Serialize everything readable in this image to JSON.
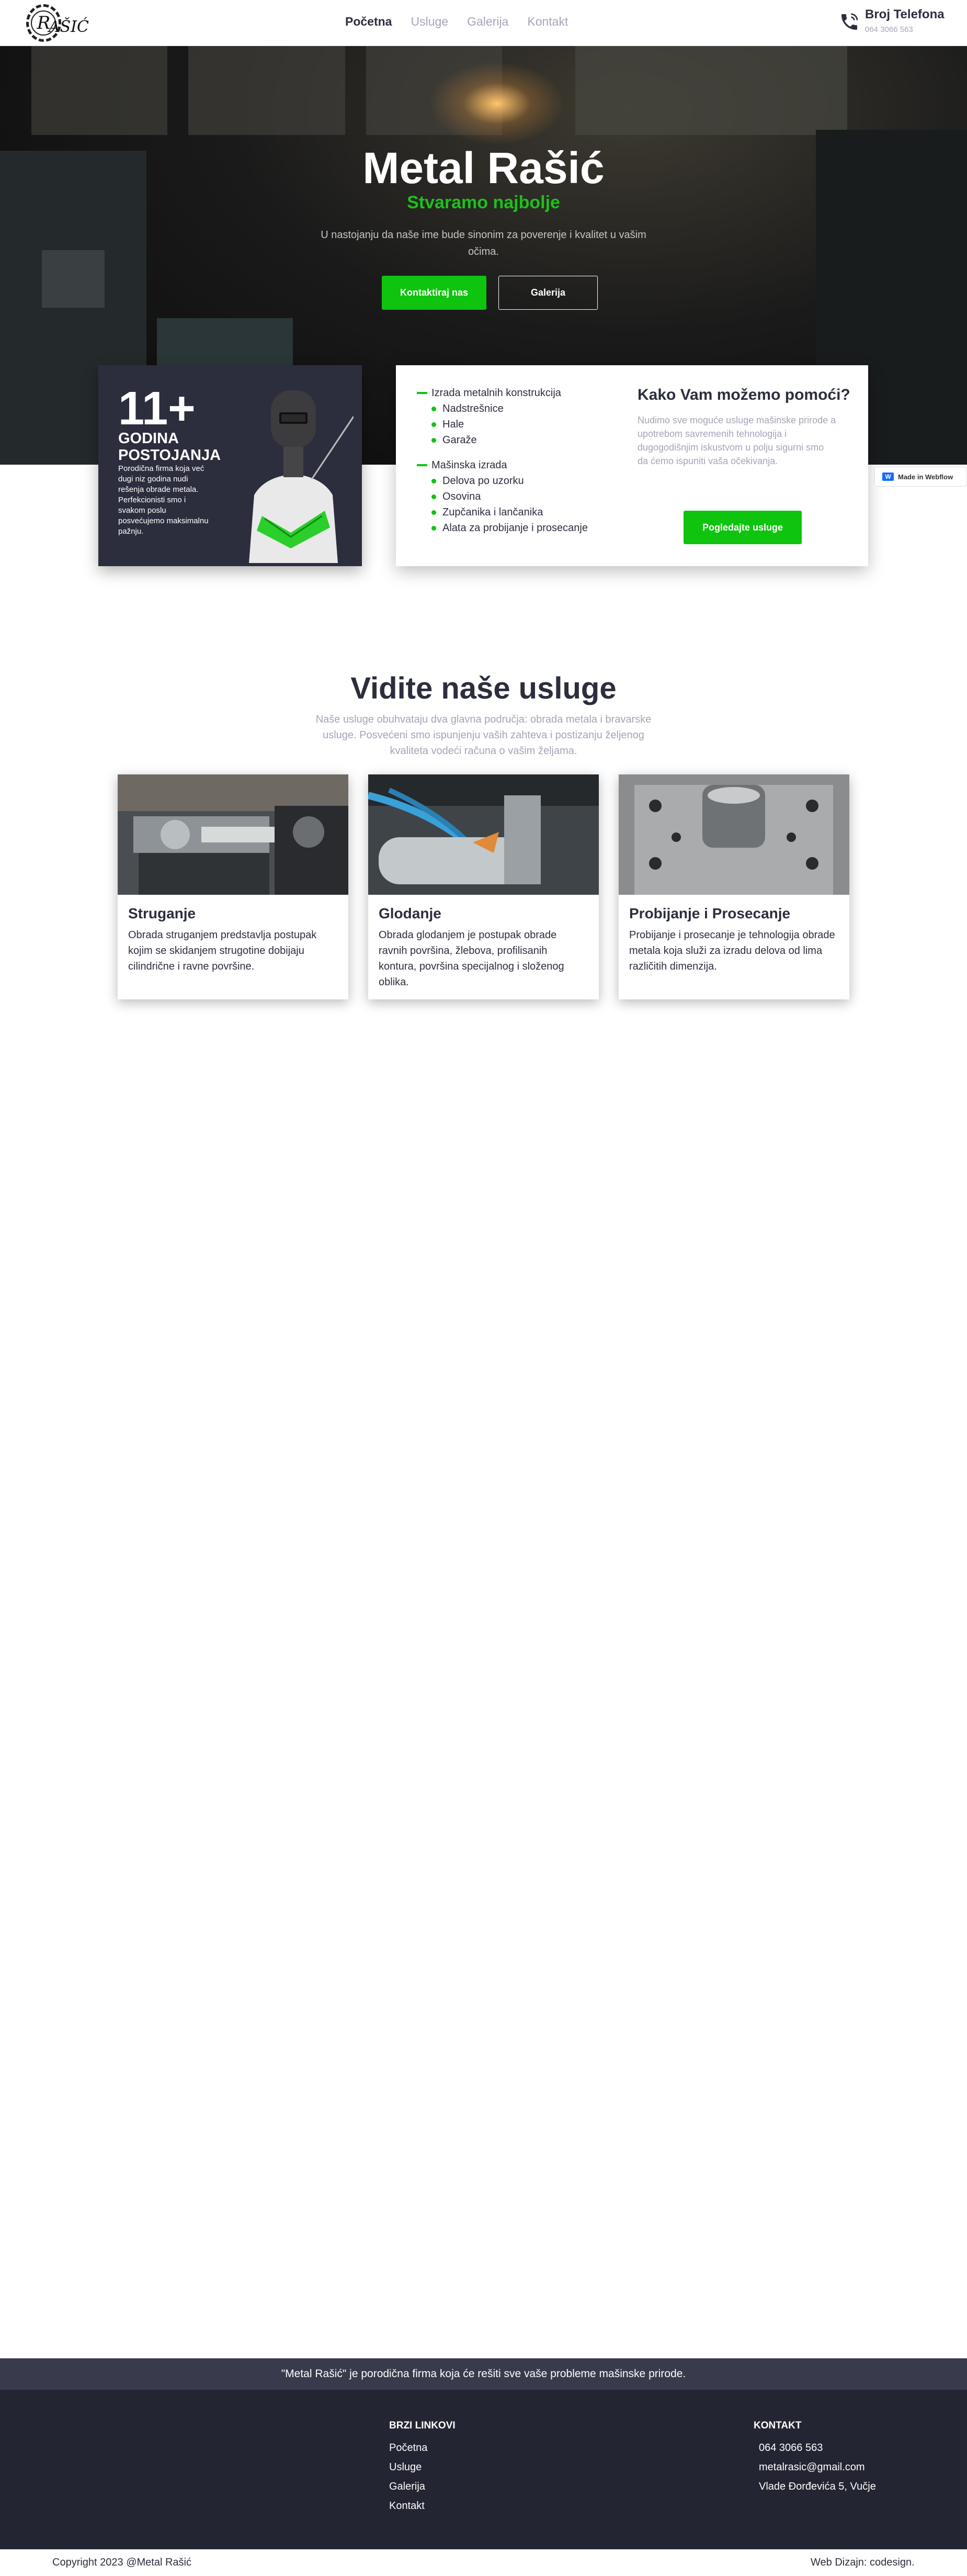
{
  "nav": {
    "logo_letter": "R",
    "logo_text": "AŠIĆ",
    "links": [
      {
        "label": "Početna",
        "active": true
      },
      {
        "label": "Usluge",
        "active": false
      },
      {
        "label": "Galerija",
        "active": false
      },
      {
        "label": "Kontakt",
        "active": false
      }
    ],
    "phone_title": "Broj Telefona",
    "phone_number": "064 3066 563"
  },
  "hero": {
    "title": "Metal Rašić",
    "subtitle": "Stvaramo najbolje",
    "text": "U nastojanju da naše ime bude sinonim za poverenje i kvalitet u vašim očima.",
    "btn_contact": "Kontaktiraj nas",
    "btn_gallery": "Galerija"
  },
  "experience": {
    "number": "11+",
    "label": "GODINA POSTOJANJA",
    "text": "Porodična firma koja već dugi niz godina nudi rešenja obrade metala. Perfekcionisti smo i svakom poslu posvećujemo maksimalnu pažnju."
  },
  "services_box": {
    "groups": [
      {
        "title": "Izrada metalnih konstrukcija",
        "items": [
          "Nadstrešnice",
          "Hale",
          "Garaže"
        ]
      },
      {
        "title": "Mašinska izrada",
        "items": [
          "Delova po uzorku",
          "Osovina",
          "Zupčanika i lančanika",
          "Alata za probijanje i prosecanje"
        ]
      }
    ],
    "help_title": "Kako Vam možemo pomoći?",
    "help_text": "Nudimo sve moguće usluge mašinske prirode a upotrebom savremenih tehnologija i dugogodišnjim iskustvom u polju sigurni smo da ćemo ispuniti vaša očekivanja.",
    "button": "Pogledajte usluge"
  },
  "webflow_badge": "Made in Webflow",
  "section": {
    "title": "Vidite naše usluge",
    "text": "Naše usluge obuhvataju dva glavna područja: obrada metala i bravarske usluge. Posvećeni smo ispunjenju vaših zahteva i postizanju željenog kvaliteta vodeći računa o vašim željama.",
    "cards": [
      {
        "title": "Struganje",
        "text": "Obrada struganjem predstavlja postupak kojim se skidanjem strugotine dobijaju cilindrične i ravne površine."
      },
      {
        "title": "Glodanje",
        "text": "Obrada glodanjem je postupak obrade ravnih površina, žlebova, profilisanih kontura, površina specijalnog i složenog oblika."
      },
      {
        "title": "Probijanje i Prosecanje",
        "text": "Probijanje i prosecanje je tehnologija obrade metala koja služi za izradu delova od lima različitih dimenzija."
      }
    ]
  },
  "footer": {
    "tagline": "\"Metal Rašić\" je porodična firma koja će rešiti sve vaše probleme mašinske prirode.",
    "links_title": "BRZI LINKOVI",
    "links": [
      "Početna",
      "Usluge",
      "Galerija",
      "Kontakt"
    ],
    "contact_title": "KONTAKT",
    "contact": [
      "064 3066 563",
      "metalrasic@gmail.com",
      "Vlade Đorđevića 5, Vučje"
    ],
    "copyright": "Copyright 2023 @Metal Rašić",
    "credit": "Web Dizajn: codesign."
  },
  "colors": {
    "accent": "#0ec40e",
    "dark": "#2c2e3e",
    "muted": "#a3a5b8",
    "footer": "#242532"
  }
}
